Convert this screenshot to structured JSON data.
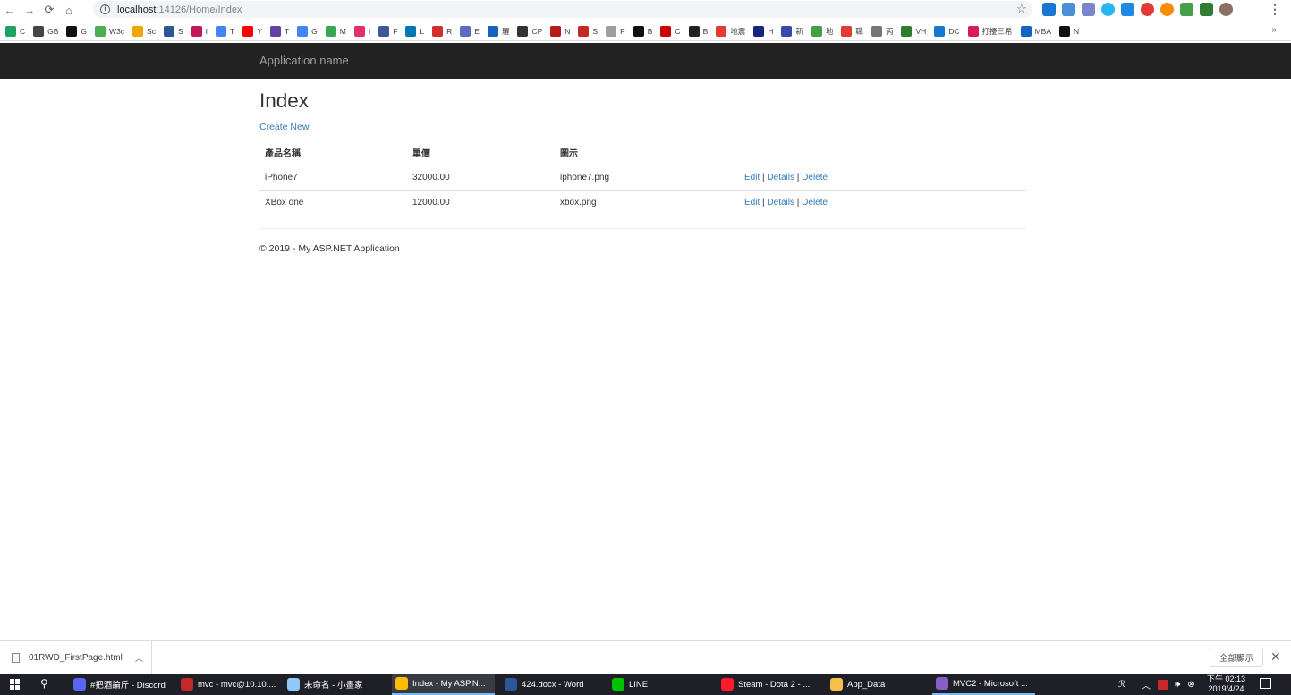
{
  "browser": {
    "url_host": "localhost",
    "url_rest": ":14126/Home/Index",
    "bookmarks": [
      {
        "label": "C",
        "color": "#1ea362"
      },
      {
        "label": "GB",
        "color": "#444444"
      },
      {
        "label": "G",
        "color": "#111111"
      },
      {
        "label": "W3c",
        "color": "#4caf50"
      },
      {
        "label": "Sc",
        "color": "#f0a500"
      },
      {
        "label": "S",
        "color": "#2b5797"
      },
      {
        "label": "I",
        "color": "#c2185b"
      },
      {
        "label": "T",
        "color": "#4285f4"
      },
      {
        "label": "Y",
        "color": "#ff0000"
      },
      {
        "label": "T",
        "color": "#6441a5"
      },
      {
        "label": "G",
        "color": "#4285f4"
      },
      {
        "label": "M",
        "color": "#34a853"
      },
      {
        "label": "I",
        "color": "#e1306c"
      },
      {
        "label": "F",
        "color": "#3b5998"
      },
      {
        "label": "L",
        "color": "#0077b5"
      },
      {
        "label": "R",
        "color": "#d32f2f"
      },
      {
        "label": "E",
        "color": "#5c6bc0"
      },
      {
        "label": "羅",
        "color": "#1565c0"
      },
      {
        "label": "CP",
        "color": "#333333"
      },
      {
        "label": "N",
        "color": "#b71c1c"
      },
      {
        "label": "S",
        "color": "#c62828"
      },
      {
        "label": "P",
        "color": "#9e9e9e"
      },
      {
        "label": "B",
        "color": "#111111"
      },
      {
        "label": "C",
        "color": "#cc0000"
      },
      {
        "label": "B",
        "color": "#222222"
      },
      {
        "label": "地震",
        "color": "#e53935"
      },
      {
        "label": "H",
        "color": "#1a237e"
      },
      {
        "label": "新",
        "color": "#3949ab"
      },
      {
        "label": "地",
        "color": "#43a047"
      },
      {
        "label": "職",
        "color": "#e53935"
      },
      {
        "label": "丙",
        "color": "#757575"
      },
      {
        "label": "VH",
        "color": "#2e7d32"
      },
      {
        "label": "DC",
        "color": "#1976d2"
      },
      {
        "label": "打擾三希",
        "color": "#d81b60"
      },
      {
        "label": "MBA",
        "color": "#1565c0"
      },
      {
        "label": "N",
        "color": "#111111"
      }
    ],
    "more": "»"
  },
  "app": {
    "brand": "Application name",
    "title": "Index",
    "create_new": "Create New",
    "table": {
      "headers": [
        "產品名稱",
        "單價",
        "圖示"
      ],
      "rows": [
        {
          "name": "iPhone7",
          "price": "32000.00",
          "image": "iphone7.png"
        },
        {
          "name": "XBox one",
          "price": "12000.00",
          "image": "xbox.png"
        }
      ],
      "actions": {
        "edit": "Edit",
        "details": "Details",
        "delete": "Delete",
        "sep": "|"
      }
    },
    "footer": "© 2019 - My ASP.NET Application"
  },
  "downloads": {
    "file": "01RWD_FirstPage.html",
    "show_all": "全部顯示"
  },
  "taskbar": {
    "tasks": [
      {
        "label": "#把酒論斤 - Discord",
        "color": "#5865f2"
      },
      {
        "label": "mvc - mvc@10.10....",
        "color": "#c62828"
      },
      {
        "label": "未命名 - 小畫家",
        "color": "#90caf9"
      },
      {
        "label": "Index - My ASP.N...",
        "color": "#fbbc04"
      },
      {
        "label": "424.docx - Word",
        "color": "#2b579a"
      },
      {
        "label": "LINE",
        "color": "#00c300"
      },
      {
        "label": "Steam - Dota 2 - ...",
        "color": "#ff1b2d"
      },
      {
        "label": "App_Data",
        "color": "#f5c04a"
      },
      {
        "label": "MVC2 - Microsoft ...",
        "color": "#865fc5"
      }
    ],
    "time": "下午 02:13",
    "date": "2019/4/24"
  },
  "colors": {
    "link": "#337ab7",
    "navbar": "#222222"
  }
}
